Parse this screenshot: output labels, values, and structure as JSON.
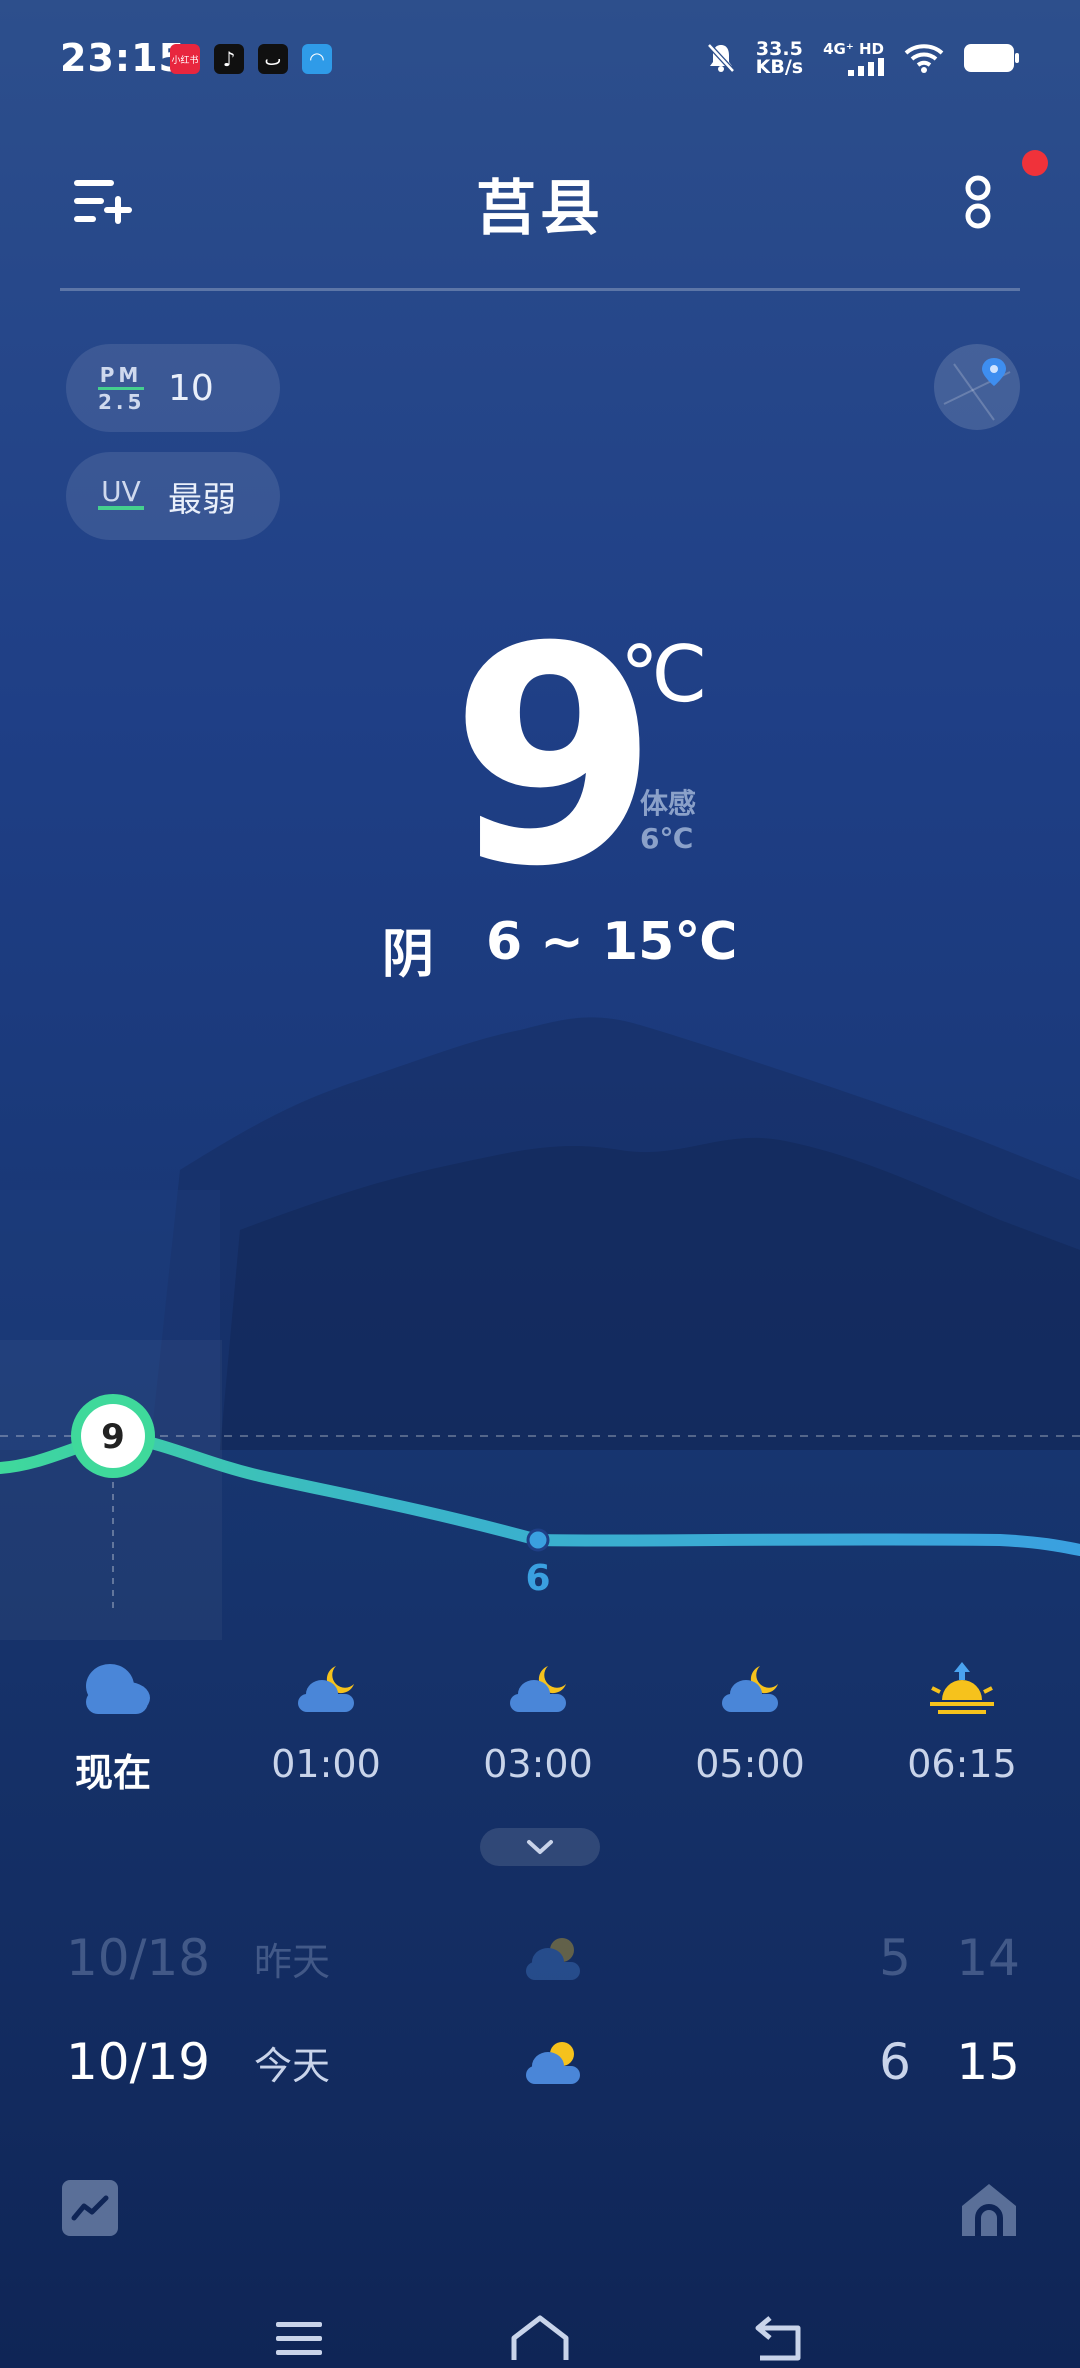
{
  "status_bar": {
    "time": "23:15",
    "apps": [
      {
        "name": "xiaohongshu",
        "label": "小红书",
        "color": "#e8263e"
      },
      {
        "name": "douyin",
        "label": "♪",
        "color": "#101010"
      },
      {
        "name": "app-smile",
        "label": "ٮ",
        "color": "#101010"
      },
      {
        "name": "app-blue",
        "label": "◠",
        "color": "#2f9be8"
      }
    ],
    "net_speed_value": "33.5",
    "net_speed_unit": "KB/s",
    "signal_label": "4G⁺ HD"
  },
  "header": {
    "city": "莒县",
    "menu_icon": "add-city-icon",
    "more_icon": "more-icon"
  },
  "air": {
    "pm_label_top": "PM",
    "pm_label_bottom": "2.5",
    "pm_value": "10",
    "uv_label": "UV",
    "uv_value": "最弱"
  },
  "current": {
    "temp": "9",
    "unit": "℃",
    "feels_label": "体感",
    "feels_value": "6℃",
    "condition": "阴",
    "range": "6 ~ 15℃"
  },
  "hourly": {
    "now_temp": "9",
    "low_temp": "6",
    "items": [
      {
        "time": "现在",
        "icon": "cloudy-icon"
      },
      {
        "time": "01:00",
        "icon": "cloudy-night-icon"
      },
      {
        "time": "03:00",
        "icon": "cloudy-night-icon"
      },
      {
        "time": "05:00",
        "icon": "cloudy-night-icon"
      },
      {
        "time": "06:15",
        "icon": "sunrise-icon"
      }
    ]
  },
  "daily": [
    {
      "date": "10/18",
      "day": "昨天",
      "icon": "partly-cloudy-icon",
      "low": "5",
      "high": "14"
    },
    {
      "date": "10/19",
      "day": "今天",
      "icon": "partly-cloudy-icon",
      "low": "6",
      "high": "15"
    }
  ],
  "colors": {
    "accent_green": "#3fd99b",
    "accent_blue": "#3aa0e0",
    "sun_yellow": "#f6c21c",
    "cloud_blue": "#4a86d8"
  }
}
